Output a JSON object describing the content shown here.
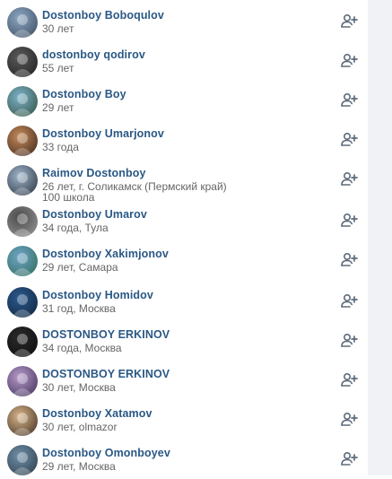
{
  "people": [
    {
      "name": "Dostonboy Boboqulov",
      "lines": [
        "30 лет"
      ],
      "avatar_colors": [
        "#8aa6c2",
        "#3b4a5c"
      ],
      "avatar_icon": "person-photo"
    },
    {
      "name": "dostonboy qodirov",
      "lines": [
        "55 лет"
      ],
      "avatar_colors": [
        "#5a5a5a",
        "#1e1e1e"
      ],
      "avatar_icon": "person-photo"
    },
    {
      "name": "Dostonboy Boy",
      "lines": [
        "29 лет"
      ],
      "avatar_colors": [
        "#7cb0c9",
        "#2f4f3b"
      ],
      "avatar_icon": "person-photo"
    },
    {
      "name": "Dostonboy Umarjonov",
      "lines": [
        "33 года"
      ],
      "avatar_colors": [
        "#c48a5a",
        "#3a2418"
      ],
      "avatar_icon": "person-photo"
    },
    {
      "name": "Raimov Dostonboy",
      "lines": [
        "26 лет, г. Соликамск (Пермский край)",
        "100 школа"
      ],
      "avatar_colors": [
        "#9fb3c8",
        "#24303d"
      ],
      "avatar_icon": "person-photo"
    },
    {
      "name": "Dostonboy Umarov",
      "lines": [
        "34 года, Тула"
      ],
      "avatar_colors": [
        "#4a4a4a",
        "#9a9a9a"
      ],
      "avatar_icon": "person-photo"
    },
    {
      "name": "Dostonboy Xakimjonov",
      "lines": [
        "29 лет, Самара"
      ],
      "avatar_colors": [
        "#6fa4c6",
        "#2d6a57"
      ],
      "avatar_icon": "person-photo"
    },
    {
      "name": "Dostonboy Homidov",
      "lines": [
        "31 год, Москва"
      ],
      "avatar_colors": [
        "#2b5a8c",
        "#10233b"
      ],
      "avatar_icon": "person-photo"
    },
    {
      "name": "DOSTONBOY ERKINOV",
      "lines": [
        "34 года, Москва"
      ],
      "avatar_colors": [
        "#2a2a2a",
        "#0c0c0c"
      ],
      "avatar_icon": "person-photo"
    },
    {
      "name": "DOSTONBOY ERKINOV",
      "lines": [
        "30 лет, Москва"
      ],
      "avatar_colors": [
        "#b59ac8",
        "#3e2c55"
      ],
      "avatar_icon": "person-photo"
    },
    {
      "name": "Dostonboy Xatamov",
      "lines": [
        "30 лет, olmazor"
      ],
      "avatar_colors": [
        "#d7b48a",
        "#3b2a1d"
      ],
      "avatar_icon": "person-photo"
    },
    {
      "name": "Dostonboy Omonboyev",
      "lines": [
        "29 лет, Москва"
      ],
      "avatar_colors": [
        "#6f8fa8",
        "#2a3a48"
      ],
      "avatar_icon": "person-photo"
    }
  ],
  "colors": {
    "name": "#2a5885",
    "meta": "#656565",
    "icon": "#5c6b7a",
    "right_panel": "#f0f2f5"
  },
  "action_icon": "add-friend-icon"
}
